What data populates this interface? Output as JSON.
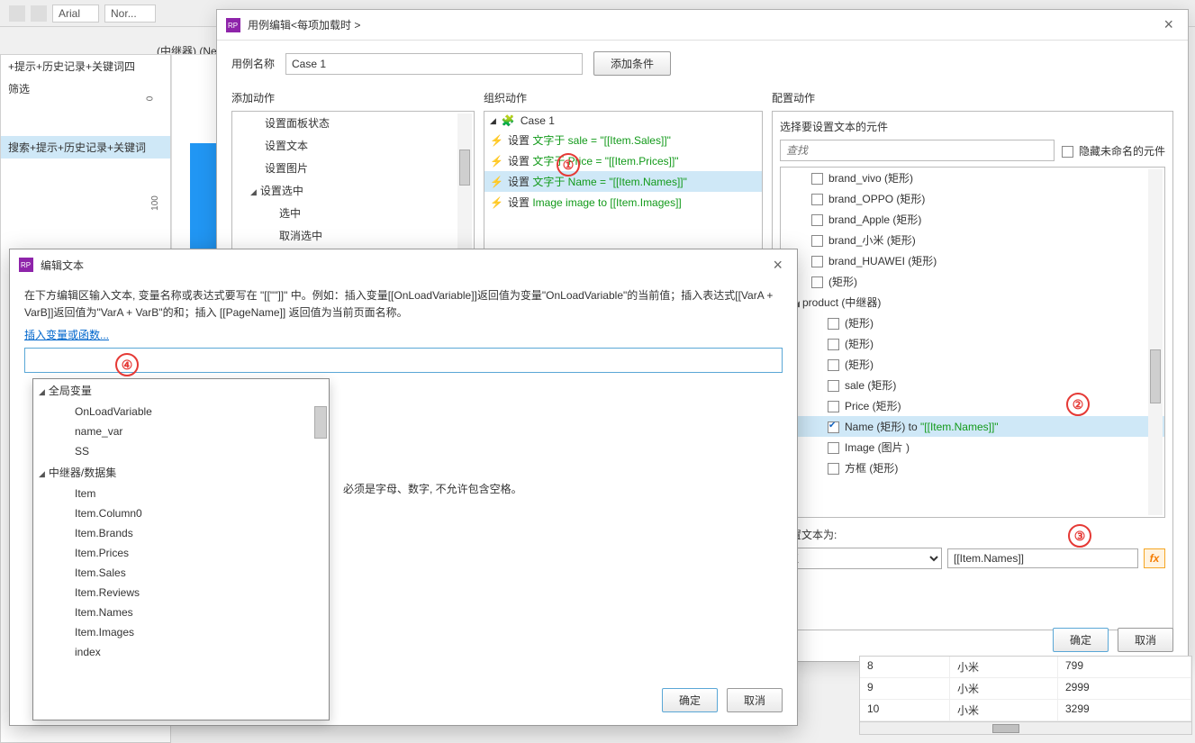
{
  "toolbar": {
    "font": "Arial",
    "fontStyle": "Nor..."
  },
  "tabLabel": "(中继器) (Ne",
  "leftTree": {
    "n1": "+提示+历史记录+关键词四",
    "filter": "筛选",
    "n2": "搜索+提示+历史记录+关键词"
  },
  "ruler": {
    "v0": "0",
    "v1": "100"
  },
  "dlgCase": {
    "title": "用例编辑<每项加载时 >",
    "nameLabel": "用例名称",
    "nameValue": "Case 1",
    "addCond": "添加条件",
    "addAction": "添加动作",
    "orgAction": "组织动作",
    "cfgAction": "配置动作",
    "ok": "确定",
    "cancel": "取消"
  },
  "actionTree": {
    "a1": "设置面板状态",
    "a2": "设置文本",
    "a3": "设置图片",
    "a4": "设置选中",
    "a5": "选中",
    "a6": "取消选中"
  },
  "caseTree": {
    "case": "Case 1",
    "s1a": "设置 ",
    "s1b": "文字于 sale = \"[[Item.Sales]]\"",
    "s2a": "设置 ",
    "s2b": "文字于 Price = \"[[Item.Prices]]\"",
    "s3a": "设置 ",
    "s3b": "文字于 Name = \"[[Item.Names]]\"",
    "s4a": "设置 ",
    "s4b": "Image image to [[Item.Images]]"
  },
  "right": {
    "chooseLabel": "选择要设置文本的元件",
    "searchPH": "查找",
    "hideUnnamed": "隐藏未命名的元件",
    "items": {
      "i0": "brand_vivo (矩形)",
      "i1": "brand_OPPO (矩形)",
      "i2": "brand_Apple (矩形)",
      "i3": "brand_小米 (矩形)",
      "i4": "brand_HUAWEI (矩形)",
      "i5": "(矩形)",
      "p": "product (中继器)",
      "c1": "(矩形)",
      "c2": "(矩形)",
      "c3": "(矩形)",
      "c4": "sale (矩形)",
      "c5": "Price (矩形)",
      "c6a": "Name (矩形) to ",
      "c6b": "\"[[Item.Names]]\"",
      "c7": "Image (图片 )",
      "c8": "方框 (矩形)"
    },
    "setTextLabel": "设置文本为:",
    "selectVal": "值",
    "inputVal": "[[Item.Names]]",
    "fx": "fx"
  },
  "dlgEdit": {
    "title": "编辑文本",
    "instr": "在下方编辑区输入文本, 变量名称或表达式要写在 \"[[\"\"]]\" 中。例如：插入变量[[OnLoadVariable]]返回值为变量\"OnLoadVariable\"的当前值；插入表达式[[VarA + VarB]]返回值为\"VarA + VarB\"的和；插入 [[PageName]] 返回值为当前页面名称。",
    "link": "插入变量或函数...",
    "hint": "必须是字母、数字, 不允许包含空格。",
    "ok": "确定",
    "cancel": "取消"
  },
  "dropdown": {
    "g1": "全局变量",
    "g1i1": "OnLoadVariable",
    "g1i2": "name_var",
    "g1i3": "SS",
    "g2": "中继器/数据集",
    "g2i1": "Item",
    "g2i2": "Item.Column0",
    "g2i3": "Item.Brands",
    "g2i4": "Item.Prices",
    "g2i5": "Item.Sales",
    "g2i6": "Item.Reviews",
    "g2i7": "Item.Names",
    "g2i8": "Item.Images",
    "g2i9": "index"
  },
  "table": {
    "r1c1": "8",
    "r1c2": "小米",
    "r1c3": "799",
    "r2c1": "9",
    "r2c2": "小米",
    "r2c3": "2999",
    "r3c1": "10",
    "r3c2": "小米",
    "r3c3": "3299"
  },
  "anno": {
    "a1": "①",
    "a2": "②",
    "a3": "③",
    "a4": "④"
  }
}
